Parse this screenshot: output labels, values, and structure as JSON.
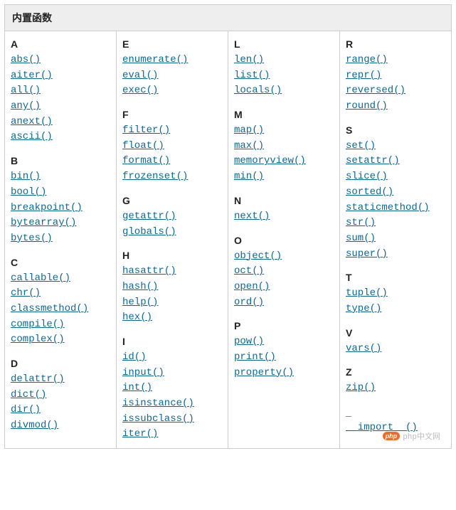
{
  "title": "内置函数",
  "watermark_text": "php中文网",
  "watermark_logo": "php",
  "columns": [
    [
      {
        "letter": "A",
        "items": [
          "abs()",
          "aiter()",
          "all()",
          "any()",
          "anext()",
          "ascii()"
        ]
      },
      {
        "letter": "B",
        "items": [
          "bin()",
          "bool()",
          "breakpoint()",
          "bytearray()",
          "bytes()"
        ]
      },
      {
        "letter": "C",
        "items": [
          "callable()",
          "chr()",
          "classmethod()",
          "compile()",
          "complex()"
        ]
      },
      {
        "letter": "D",
        "items": [
          "delattr()",
          "dict()",
          "dir()",
          "divmod()"
        ]
      }
    ],
    [
      {
        "letter": "E",
        "items": [
          "enumerate()",
          "eval()",
          "exec()"
        ]
      },
      {
        "letter": "F",
        "items": [
          "filter()",
          "float()",
          "format()",
          "frozenset()"
        ]
      },
      {
        "letter": "G",
        "items": [
          "getattr()",
          "globals()"
        ]
      },
      {
        "letter": "H",
        "items": [
          "hasattr()",
          "hash()",
          "help()",
          "hex()"
        ]
      },
      {
        "letter": "I",
        "items": [
          "id()",
          "input()",
          "int()",
          "isinstance()",
          "issubclass()",
          "iter()"
        ]
      }
    ],
    [
      {
        "letter": "L",
        "items": [
          "len()",
          "list()",
          "locals()"
        ]
      },
      {
        "letter": "M",
        "items": [
          "map()",
          "max()",
          "memoryview()",
          "min()"
        ]
      },
      {
        "letter": "N",
        "items": [
          "next()"
        ]
      },
      {
        "letter": "O",
        "items": [
          "object()",
          "oct()",
          "open()",
          "ord()"
        ]
      },
      {
        "letter": "P",
        "items": [
          "pow()",
          "print()",
          "property()"
        ]
      }
    ],
    [
      {
        "letter": "R",
        "items": [
          "range()",
          "repr()",
          "reversed()",
          "round()"
        ]
      },
      {
        "letter": "S",
        "items": [
          "set()",
          "setattr()",
          "slice()",
          "sorted()",
          "staticmethod()",
          "str()",
          "sum()",
          "super()"
        ]
      },
      {
        "letter": "T",
        "items": [
          "tuple()",
          "type()"
        ]
      },
      {
        "letter": "V",
        "items": [
          "vars()"
        ]
      },
      {
        "letter": "Z",
        "items": [
          "zip()"
        ]
      },
      {
        "letter": "_",
        "items": [
          "__import__()"
        ]
      }
    ]
  ]
}
